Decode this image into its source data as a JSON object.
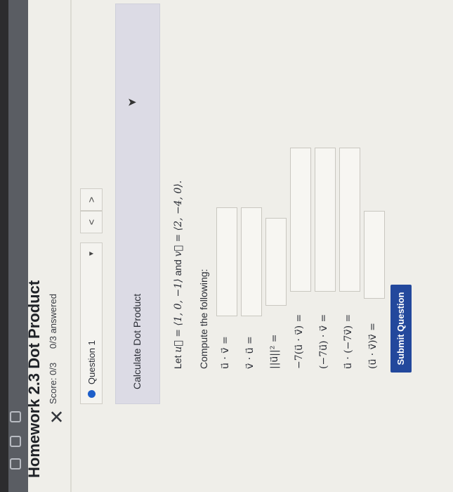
{
  "page": {
    "title": "Homework 2.3 Dot Product",
    "score": "Score: 0/3",
    "answered": "0/3 answered",
    "close_symbol": "✕"
  },
  "question_nav": {
    "selected": "Question 1",
    "prev_symbol": "<",
    "next_symbol": ">",
    "caret_symbol": "▼"
  },
  "problem": {
    "header": "Calculate Dot Product",
    "statement_prefix": "Let ",
    "statement_u": "u⃗ = ⟨1, 0, −1⟩",
    "statement_mid": " and ",
    "statement_v": "v⃗ = ⟨2, −4, 0⟩.",
    "compute_label": "Compute the following:",
    "items": [
      {
        "label": "u⃗ · v⃗ ="
      },
      {
        "label": "v⃗ · u⃗ ="
      },
      {
        "label": "||u⃗||² ="
      },
      {
        "label": "−7(u⃗ · v⃗) ="
      },
      {
        "label": "(−7u⃗) · v⃗ ="
      },
      {
        "label": "u⃗ · (−7v⃗) ="
      },
      {
        "label": "(u⃗ · v⃗)v⃗ ="
      }
    ]
  },
  "actions": {
    "submit_label": "Submit Question"
  }
}
